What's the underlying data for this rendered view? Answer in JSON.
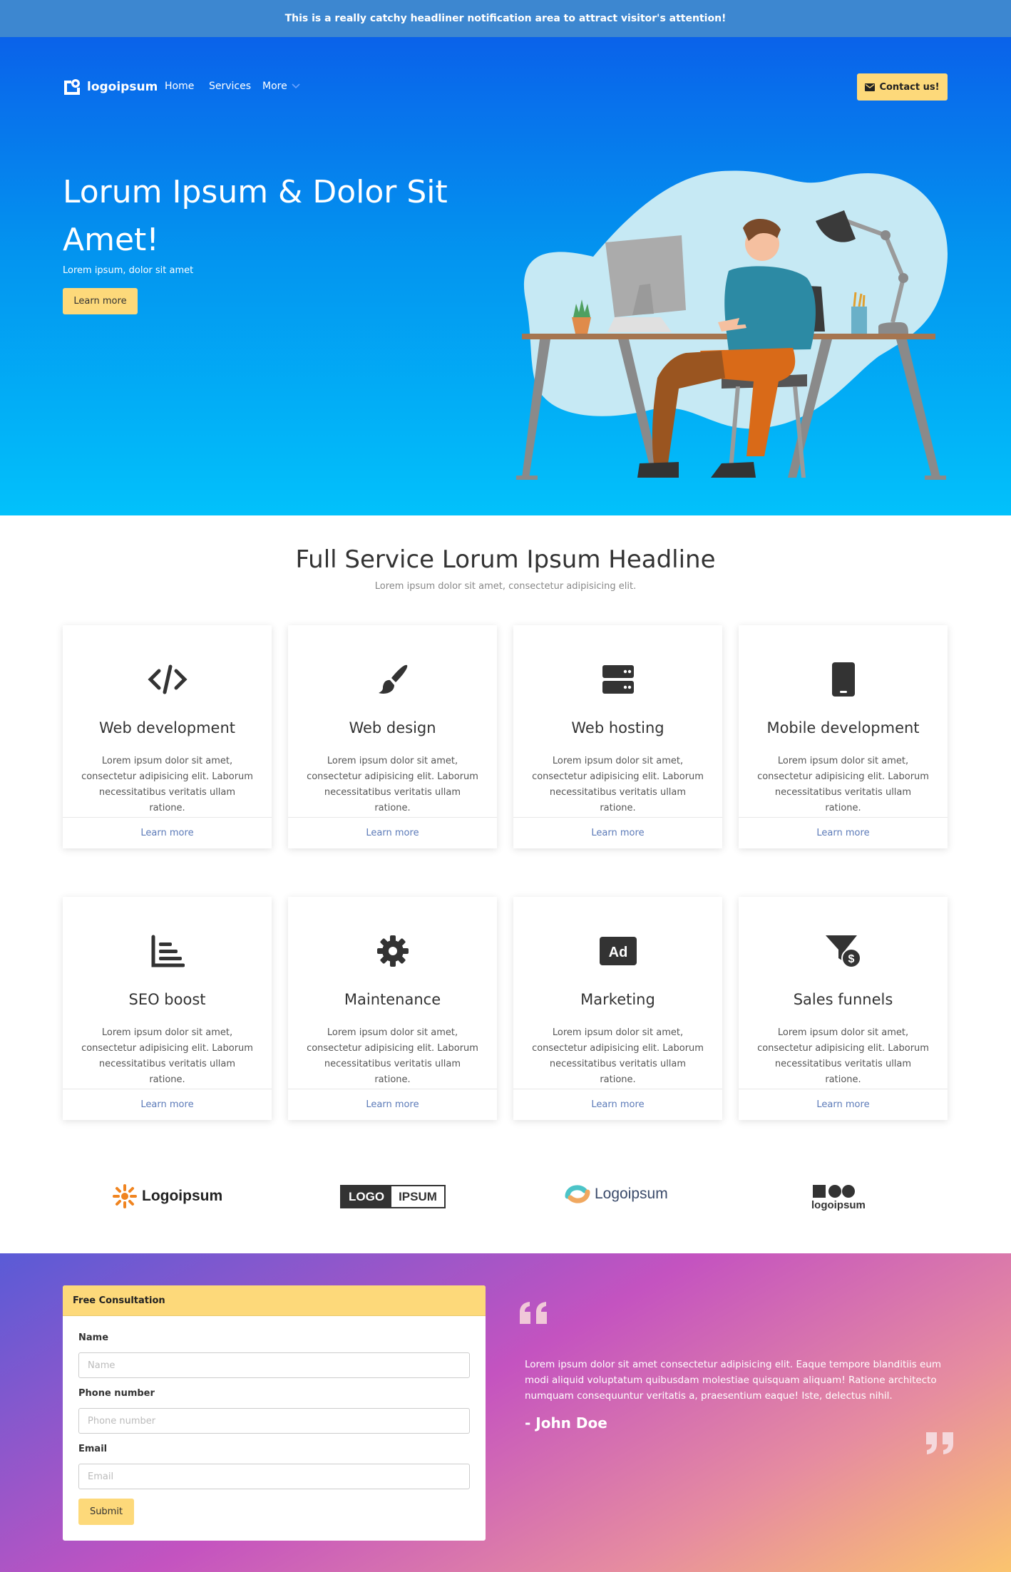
{
  "notification": "This is a really catchy headliner notification area to attract visitor's attention!",
  "header": {
    "logo_text": "logoipsum",
    "nav": [
      "Home",
      "Services",
      "More"
    ],
    "contact_label": "Contact us!"
  },
  "hero": {
    "title": "Lorum Ipsum & Dolor Sit Amet!",
    "subtitle": "Lorem ipsum, dolor sit amet",
    "button": "Learn more"
  },
  "services": {
    "title": "Full Service Lorum Ipsum Headline",
    "subtitle": "Lorem ipsum dolor sit amet, consectetur adipisicing elit.",
    "items": [
      {
        "icon": "code-icon",
        "title": "Web development",
        "text": "Lorem ipsum dolor sit amet, consectetur adipisicing elit. Laborum necessitatibus veritatis ullam ratione.",
        "link": "Learn more"
      },
      {
        "icon": "paintbrush-icon",
        "title": "Web design",
        "text": "Lorem ipsum dolor sit amet, consectetur adipisicing elit. Laborum necessitatibus veritatis ullam ratione.",
        "link": "Learn more"
      },
      {
        "icon": "server-icon",
        "title": "Web hosting",
        "text": "Lorem ipsum dolor sit amet, consectetur adipisicing elit. Laborum necessitatibus veritatis ullam ratione.",
        "link": "Learn more"
      },
      {
        "icon": "mobile-icon",
        "title": "Mobile development",
        "text": "Lorem ipsum dolor sit amet, consectetur adipisicing elit. Laborum necessitatibus veritatis ullam ratione.",
        "link": "Learn more"
      },
      {
        "icon": "chart-bar-icon",
        "title": "SEO boost",
        "text": "Lorem ipsum dolor sit amet, consectetur adipisicing elit. Laborum necessitatibus veritatis ullam ratione.",
        "link": "Learn more"
      },
      {
        "icon": "gear-icon",
        "title": "Maintenance",
        "text": "Lorem ipsum dolor sit amet, consectetur adipisicing elit. Laborum necessitatibus veritatis ullam ratione.",
        "link": "Learn more"
      },
      {
        "icon": "ad-icon",
        "title": "Marketing",
        "text": "Lorem ipsum dolor sit amet, consectetur adipisicing elit. Laborum necessitatibus veritatis ullam ratione.",
        "link": "Learn more"
      },
      {
        "icon": "funnel-dollar-icon",
        "title": "Sales funnels",
        "text": "Lorem ipsum dolor sit amet, consectetur adipisicing elit. Laborum necessitatibus veritatis ullam ratione.",
        "link": "Learn more"
      }
    ]
  },
  "partner_logos": {
    "logo1": "Logoipsum",
    "logo2_a": "LOGO",
    "logo2_b": "IPSUM",
    "logo3": "Logoipsum",
    "logo4": "logoipsum"
  },
  "form": {
    "header": "Free Consultation",
    "fields": [
      {
        "label": "Name",
        "placeholder": "Name"
      },
      {
        "label": "Phone number",
        "placeholder": "Phone number"
      },
      {
        "label": "Email",
        "placeholder": "Email"
      }
    ],
    "submit": "Submit"
  },
  "testimonial": {
    "text": "Lorem ipsum dolor sit amet consectetur adipisicing elit. Eaque tempore blanditiis eum modi aliquid voluptatum quibusdam molestiae quisquam aliquam! Ratione architecto numquam consequuntur veritatis a, praesentium eaque! Iste, delectus nihil.",
    "author": "- John Doe"
  },
  "colors": {
    "accent": "#fdd97a",
    "hero_top": "#0a62ea",
    "hero_bottom": "#02c1fb",
    "link": "#5b7ab8"
  }
}
